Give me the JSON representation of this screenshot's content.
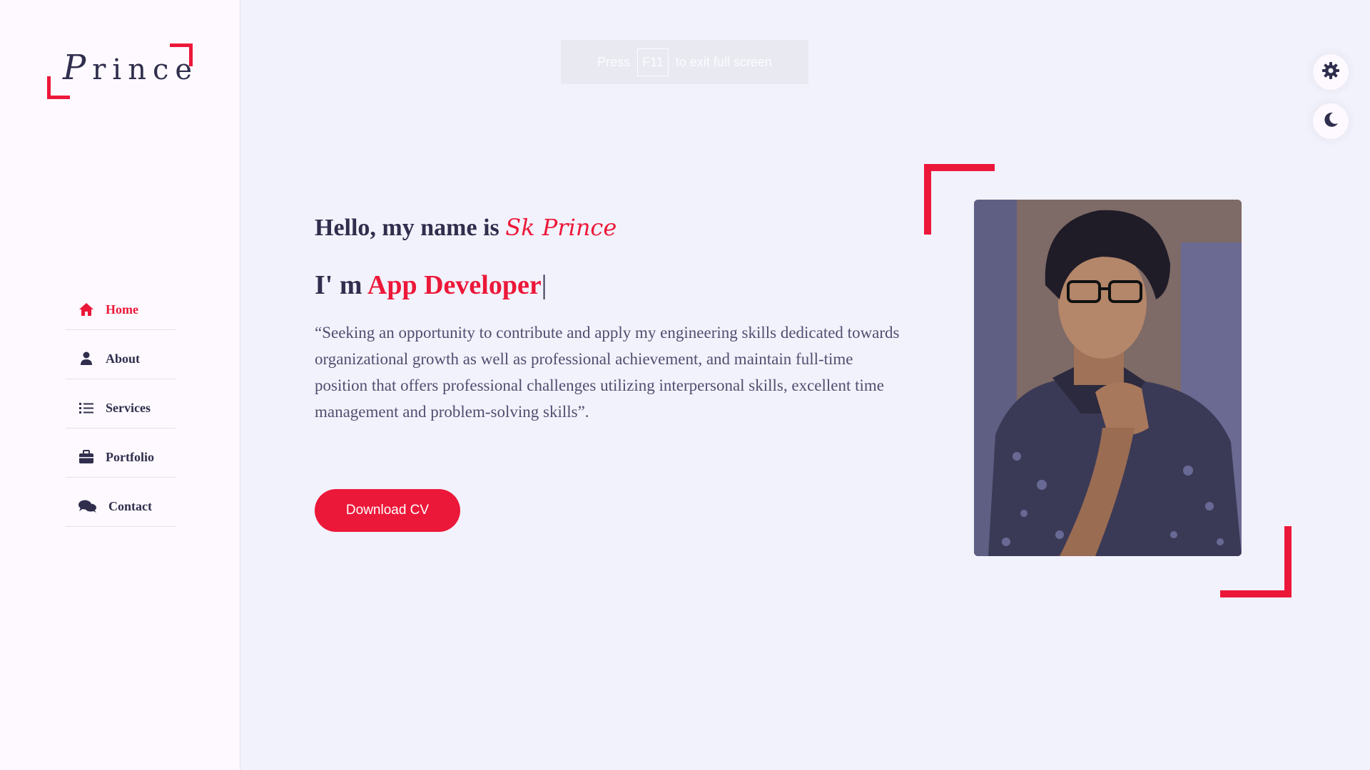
{
  "logo": {
    "first_letter": "P",
    "rest": "rince"
  },
  "nav": [
    {
      "label": "Home",
      "icon": "home-icon",
      "active": true
    },
    {
      "label": "About",
      "icon": "user-icon",
      "active": false
    },
    {
      "label": "Services",
      "icon": "list-icon",
      "active": false
    },
    {
      "label": "Portfolio",
      "icon": "briefcase-icon",
      "active": false
    },
    {
      "label": "Contact",
      "icon": "comments-icon",
      "active": false
    }
  ],
  "toast": {
    "before": "Press",
    "key": "F11",
    "after": "to exit full screen"
  },
  "hero": {
    "greeting": "Hello, my name is",
    "name": "Sk Prince",
    "role_prefix": "I' m",
    "role": "App Developer",
    "cursor": "|",
    "description": "“Seeking an opportunity to contribute and apply my engineering skills dedicated towards organizational growth as well as professional achievement, and maintain full-time position that offers professional challenges utilizing interpersonal skills, excellent time management and problem-solving skills”.",
    "cv_button": "Download CV"
  },
  "colors": {
    "accent": "#ec1839",
    "text_dark": "#302e4d",
    "background": "#f2f2fc",
    "sidebar_bg": "#fdf9ff"
  }
}
